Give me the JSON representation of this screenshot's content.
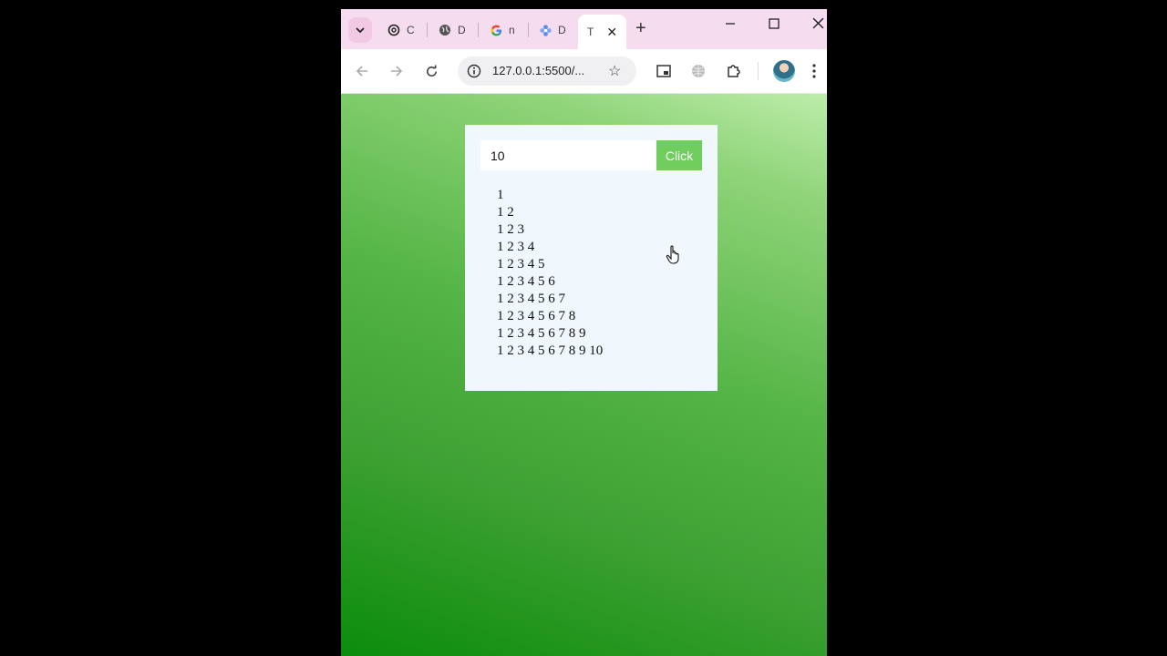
{
  "browser": {
    "tabs": [
      {
        "label": "C",
        "icon": "chatgpt-icon"
      },
      {
        "label": "D",
        "icon": "globe-icon"
      },
      {
        "label": "n",
        "icon": "google-icon"
      },
      {
        "label": "D",
        "icon": "flower-icon"
      },
      {
        "label": "T",
        "icon": "",
        "active": true
      }
    ],
    "new_tab": "+",
    "url": "127.0.0.1:5500/..."
  },
  "form": {
    "input_value": "10",
    "button_label": "Click"
  },
  "output": {
    "rows": [
      "1",
      "1 2",
      "1 2 3",
      "1 2 3 4",
      "1 2 3 4 5",
      "1 2 3 4 5 6",
      "1 2 3 4 5 6 7",
      "1 2 3 4 5 6 7 8",
      "1 2 3 4 5 6 7 8 9",
      "1 2 3 4 5 6 7 8 9 10"
    ]
  },
  "colors": {
    "button": "#6fce5d",
    "card": "#f1f8fd",
    "gradient_top": "#bdedaa",
    "gradient_bottom": "#0b8c0b"
  }
}
